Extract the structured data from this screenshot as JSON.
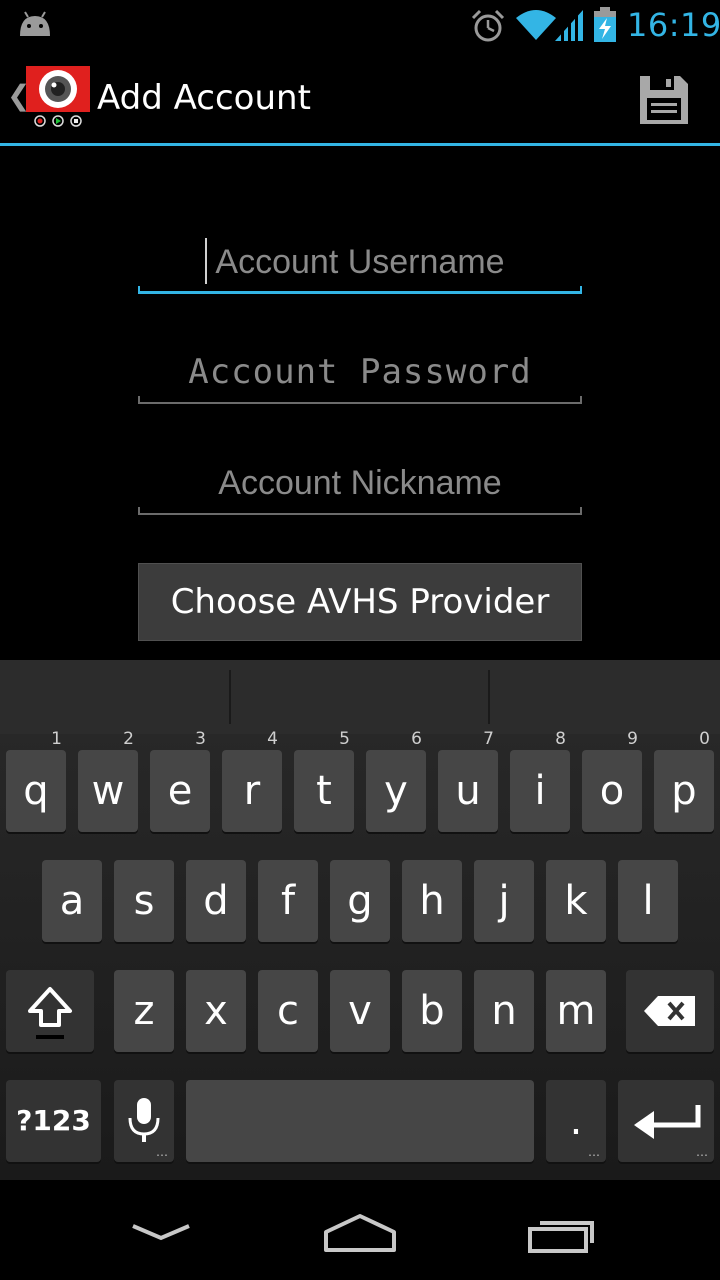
{
  "status_bar": {
    "time": "16:19",
    "icons": [
      "android-icon",
      "alarm-icon",
      "wifi-icon",
      "signal-icon",
      "battery-charging-icon"
    ],
    "accent_color": "#33b5e5"
  },
  "action_bar": {
    "title": "Add Account",
    "up_icon": "up-caret-icon",
    "app_icon": "camera-app-icon",
    "save_icon": "save-floppy-icon"
  },
  "form": {
    "username_placeholder": "Account Username",
    "username_value": "",
    "password_placeholder": "Account Password",
    "password_value": "",
    "nickname_placeholder": "Account Nickname",
    "nickname_value": "",
    "provider_button": "Choose AVHS Provider"
  },
  "keyboard": {
    "row1": [
      {
        "label": "q",
        "hint": "1"
      },
      {
        "label": "w",
        "hint": "2"
      },
      {
        "label": "e",
        "hint": "3"
      },
      {
        "label": "r",
        "hint": "4"
      },
      {
        "label": "t",
        "hint": "5"
      },
      {
        "label": "y",
        "hint": "6"
      },
      {
        "label": "u",
        "hint": "7"
      },
      {
        "label": "i",
        "hint": "8"
      },
      {
        "label": "o",
        "hint": "9"
      },
      {
        "label": "p",
        "hint": "0"
      }
    ],
    "row2": [
      "a",
      "s",
      "d",
      "f",
      "g",
      "h",
      "j",
      "k",
      "l"
    ],
    "row3": [
      "z",
      "x",
      "c",
      "v",
      "b",
      "n",
      "m"
    ],
    "symbols_label": "?123",
    "period_label": ".",
    "shift_icon": "shift-icon",
    "delete_icon": "backspace-icon",
    "mic_icon": "microphone-icon",
    "enter_icon": "enter-arrow-icon"
  },
  "nav_bar": {
    "icons": [
      "back-chevron-icon",
      "home-icon",
      "recent-apps-icon"
    ]
  }
}
